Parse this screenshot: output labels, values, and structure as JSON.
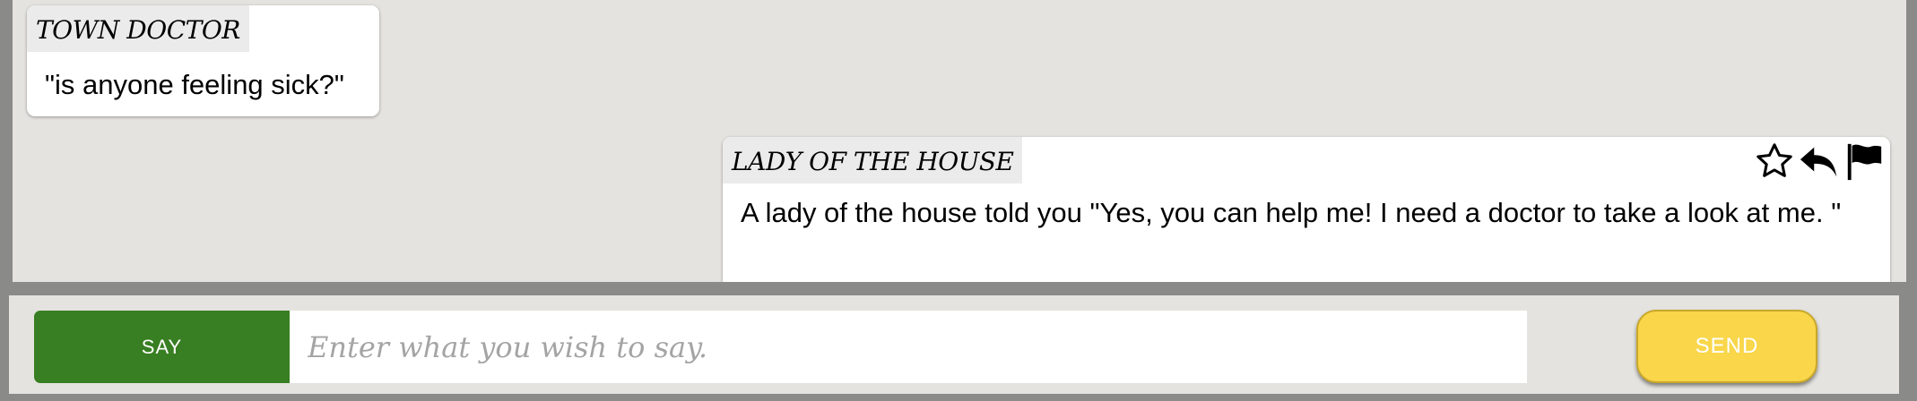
{
  "messages": [
    {
      "speaker": "TOWN DOCTOR",
      "text": "\"is anyone feeling sick?\""
    },
    {
      "speaker": "LADY OF THE HOUSE",
      "text": "A lady of the house told you \"Yes, you can help me! I need a doctor to take a look at me. \""
    }
  ],
  "message_actions": [
    "star-icon",
    "reply-icon",
    "flag-icon"
  ],
  "input_bar": {
    "mode_label": "SAY",
    "placeholder": "Enter what you wish to say.",
    "value": "",
    "send_label": "SEND"
  },
  "colors": {
    "say_button": "#387e22",
    "send_button": "#f9d64a",
    "chat_background": "#e4e3df",
    "frame": "#8a8a88"
  }
}
